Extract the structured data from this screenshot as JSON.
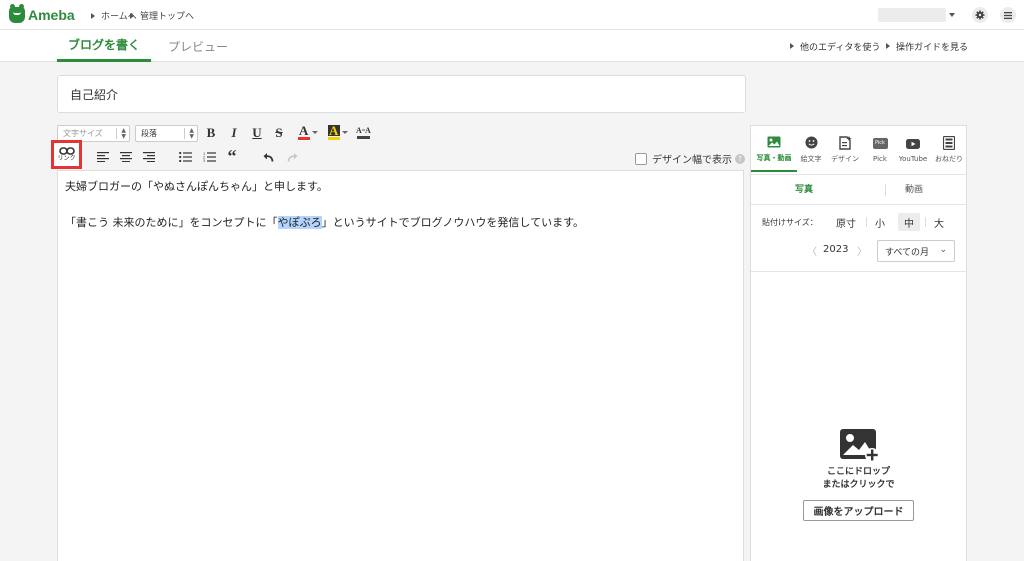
{
  "header": {
    "logo_text": "Ameba",
    "breadcrumbs": [
      "ホームへ",
      "管理トップへ"
    ]
  },
  "tabs": [
    {
      "label": "ブログを書く",
      "active": true
    },
    {
      "label": "プレビュー",
      "active": false
    }
  ],
  "top_links": [
    "他のエディタを使う",
    "操作ガイドを見る"
  ],
  "title_input": {
    "value": "自己紹介"
  },
  "toolbar": {
    "font_size_placeholder": "文字サイズ",
    "paragraph_value": "段落",
    "bold": "B",
    "italic": "I",
    "underline": "U",
    "strike": "S",
    "font_color": "A",
    "bg_color": "A",
    "link_label": "リンク",
    "quote": "“",
    "design_width_label": "デザイン幅で表示",
    "help": "?"
  },
  "editor": {
    "line1": "夫婦ブロガーの「やぬさんぽんちゃん」と申します。",
    "line2_before": "「書こう 未来のために」をコンセプトに「",
    "line2_highlight": "やぽぷろ",
    "line2_after": "」というサイトでブログノウハウを発信しています。"
  },
  "side": {
    "tabs": [
      "写真・動画",
      "絵文字",
      "デザイン",
      "Pick",
      "YouTube",
      "おねだり"
    ],
    "pick_icon_text": "Pick",
    "subtabs": [
      "写真",
      "動画"
    ],
    "size_label": "貼付けサイズ：",
    "sizes": [
      "原寸",
      "小",
      "中",
      "大"
    ],
    "selected_size": "中",
    "year": "2023",
    "prev": "〈",
    "next": "〉",
    "month_value": "すべての月",
    "drop_text_1": "ここにドロップ",
    "drop_text_2": "またはクリックで",
    "upload_button": "画像をアップロード"
  },
  "colors": {
    "brand": "#2d8c3c",
    "highlight_box": "#e53434",
    "selection": "#b3d4fd",
    "font_color_bar": "#e53434",
    "bg_color_bar": "#f5d300"
  }
}
